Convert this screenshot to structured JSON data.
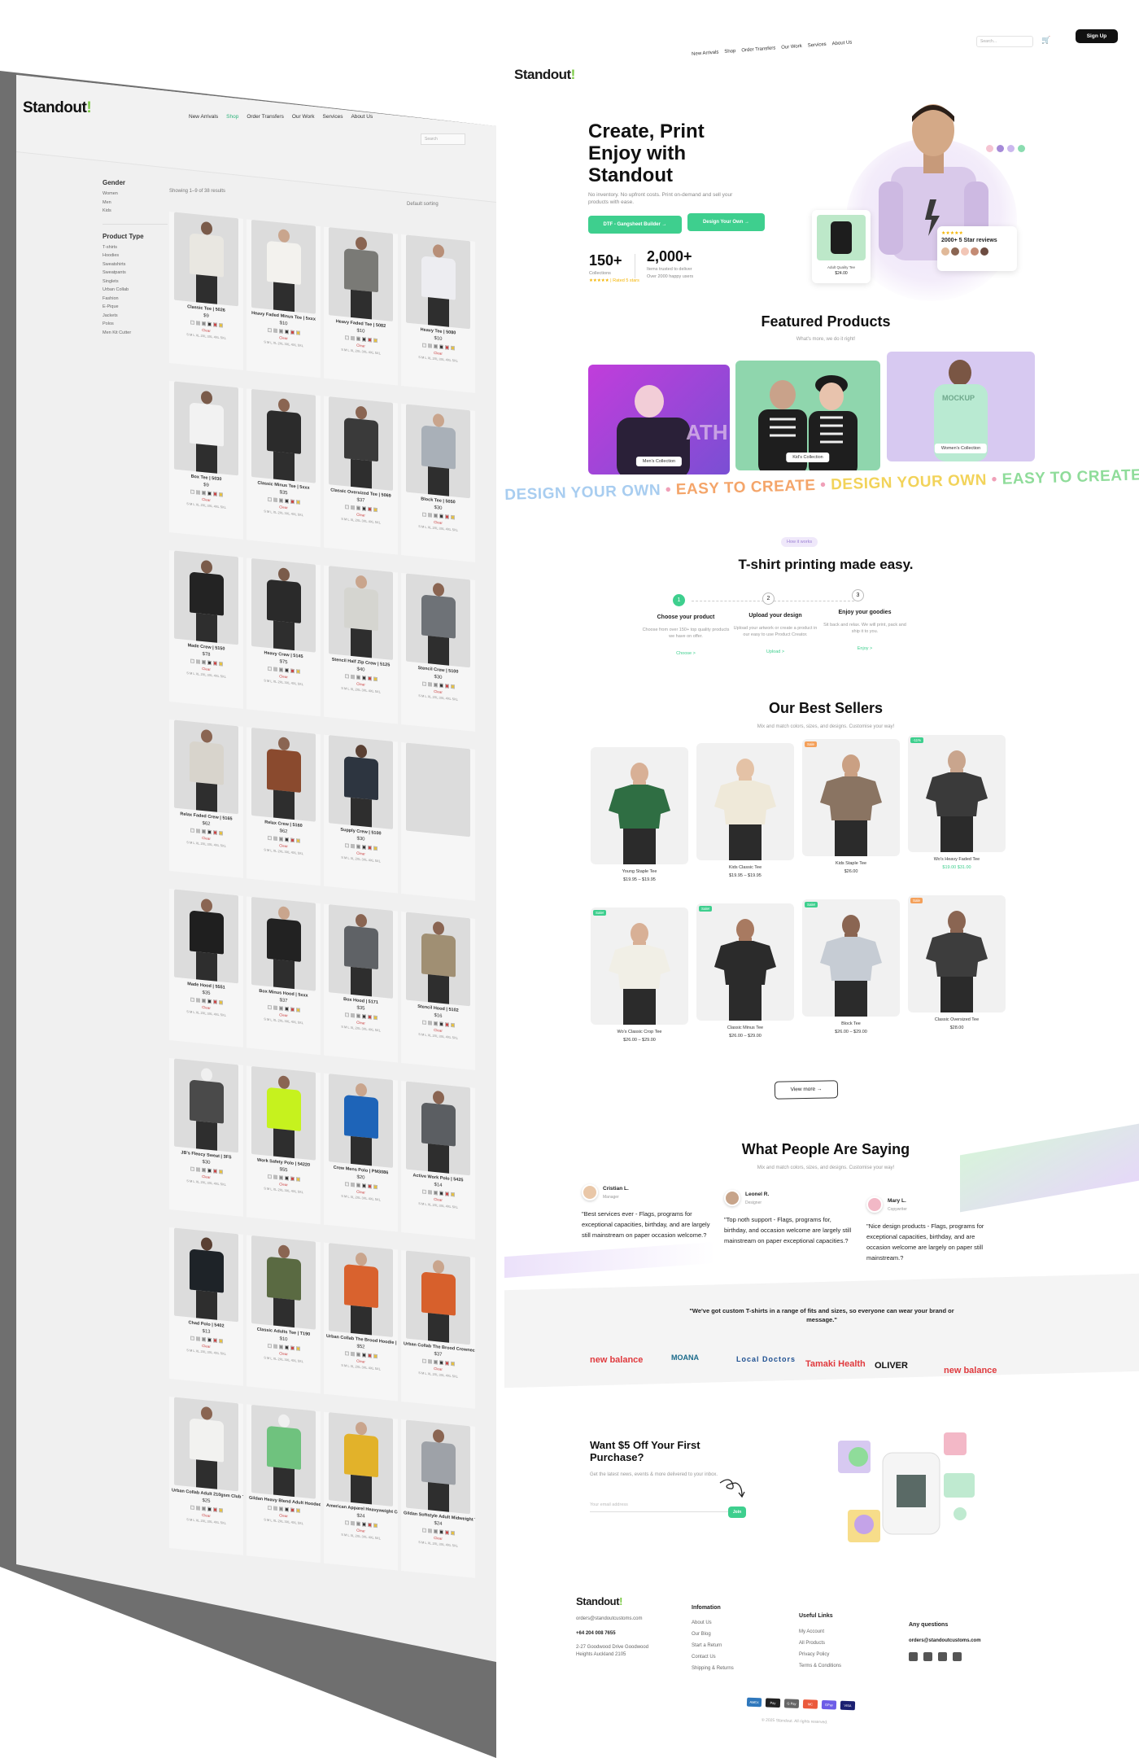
{
  "left": {
    "logo": "Standout",
    "nav": [
      "New Arrivals",
      "Shop",
      "Order Transfers",
      "Our Work",
      "Services",
      "About Us"
    ],
    "search_placeholder": "Search",
    "filters": {
      "gender_title": "Gender",
      "gender_items": [
        "Women",
        "Men",
        "Kids"
      ],
      "type_title": "Product Type",
      "type_items": [
        "T-shirts",
        "Hoodies",
        "Sweatshirts",
        "Sweatpants",
        "Singlets",
        "Urban Collab",
        "Fashion",
        "E-Pique",
        "Jackets",
        "Polos",
        "Men Kit Cutter"
      ]
    },
    "showing": "Showing 1–9 of 38 results",
    "sort": "Default sorting",
    "products": [
      {
        "name": "Classic Tee | 5026",
        "price": "$9",
        "body": "#e9e7e1",
        "skin": "#7a5b4a"
      },
      {
        "name": "Heavy Faded Minus Tee | 5xxx",
        "price": "$10",
        "body": "#f3f2ee",
        "skin": "#c9a58d"
      },
      {
        "name": "Heavy Faded Tee | 5082",
        "price": "$10",
        "body": "#7a7a76",
        "skin": "#8a6552"
      },
      {
        "name": "Heavy Tee | 5080",
        "price": "$10",
        "body": "#ededf1",
        "skin": "#b88f78"
      },
      {
        "name": "Box Tee | 5030",
        "price": "$9",
        "body": "#f2f2f2",
        "skin": "#7a5b4a"
      },
      {
        "name": "Classic Minus Tee | 5xxx",
        "price": "$35",
        "body": "#2b2b2b",
        "skin": "#8a6552"
      },
      {
        "name": "Classic Oversized Tee | 5069",
        "price": "$37",
        "body": "#3a3a3a",
        "skin": "#8a6552"
      },
      {
        "name": "Block Tee | 5050",
        "price": "$30",
        "body": "#a9b0b8",
        "skin": "#c9a58d"
      },
      {
        "name": "Made Crew | 5150",
        "price": "$78",
        "body": "#232323",
        "skin": "#7a5b4a"
      },
      {
        "name": "Heavy Crew | 5145",
        "price": "$75",
        "body": "#2a2a2a",
        "skin": "#7a5b4a"
      },
      {
        "name": "Stencil Half Zip Crew | 5125",
        "price": "$40",
        "body": "#d5d5d0",
        "skin": "#c9a58d"
      },
      {
        "name": "Stencil Crew | 5100",
        "price": "$30",
        "body": "#6e7277",
        "skin": "#8a6552"
      },
      {
        "name": "Relax Faded Crew | 5165",
        "price": "$62",
        "body": "#d8d4cc",
        "skin": "#8a6552"
      },
      {
        "name": "Relax Crew | 5160",
        "price": "$62",
        "body": "#8a4a2e",
        "skin": "#8a6552"
      },
      {
        "name": "Supply Crew | 5100",
        "price": "$30",
        "body": "#2d3540",
        "skin": "#5a4033"
      },
      {
        "name": "",
        "price": "",
        "body": "#f0f0f0",
        "skin": "#f0f0f0"
      },
      {
        "name": "Made Hood | 5551",
        "price": "$35",
        "body": "#1f1f1f",
        "skin": "#8a6552"
      },
      {
        "name": "Box Minus Hood | 5xxx",
        "price": "$37",
        "body": "#222222",
        "skin": "#c9a58d"
      },
      {
        "name": "Box Hood | 5171",
        "price": "$35",
        "body": "#5f6266",
        "skin": "#8a6552"
      },
      {
        "name": "Stencil Hood | 5102",
        "price": "$16",
        "body": "#a08f73",
        "skin": "#8a6552"
      },
      {
        "name": "JB's Fleecy Sweat | 3FS",
        "price": "$30",
        "body": "#4a4a4a",
        "skin": "#f0f0f0"
      },
      {
        "name": "Work Safety Polo | 54220",
        "price": "$55",
        "body": "#c6f21e",
        "skin": "#8a6552"
      },
      {
        "name": "Crew Mens Polo | PM3086",
        "price": "$20",
        "body": "#1e64b8",
        "skin": "#c9a58d"
      },
      {
        "name": "Active Work Polo | 5425",
        "price": "$14",
        "body": "#5b5e62",
        "skin": "#8a6552"
      },
      {
        "name": "Chad Polo | 5402",
        "price": "$13",
        "body": "#1e2328",
        "skin": "#5a4033"
      },
      {
        "name": "Classic Adults Tee | T190",
        "price": "$10",
        "body": "#5a6a42",
        "skin": "#8a6552"
      },
      {
        "name": "Urban Collab The Brood Hoodie | UCH029",
        "price": "$52",
        "body": "#d9622e",
        "skin": "#c9a58d"
      },
      {
        "name": "Urban Collab The Brood Crewneck | UCC021",
        "price": "$37",
        "body": "#d7602c",
        "skin": "#c9a58d"
      },
      {
        "name": "Urban Collab Adult 210gsm Club Tee | UCT200",
        "price": "$25",
        "body": "#f2f2f0",
        "skin": "#8a6552"
      },
      {
        "name": "Gildan Heavy Blend Adult Hooded Sweatshirt | 18500",
        "price": "",
        "body": "#6fc27e",
        "skin": "#f0f0f0"
      },
      {
        "name": "American Apparel Heavyweight Cotton Unisex T-Shirt | 1301",
        "price": "$24",
        "body": "#e2b22a",
        "skin": "#c9a58d"
      },
      {
        "name": "Gildan Softstyle Adult Midweight T-Shirt | 64000",
        "price": "$24",
        "body": "#9ea2a8",
        "skin": "#8a6552"
      }
    ]
  },
  "right": {
    "logo": "Standout",
    "nav": [
      "New Arrivals",
      "Shop",
      "Order Transfers",
      "Our Work",
      "Services",
      "About Us"
    ],
    "search_placeholder": "Search...",
    "signup": "Sign Up",
    "hero": {
      "title": "Create, Print Enjoy with Standout",
      "sub": "No inventory. No upfront costs. Print on-demand and sell your products with ease.",
      "btn1": "DTF - Gangsheet Builder →",
      "btn2": "Design Your Own →",
      "stat1_num": "150+",
      "stat1_lbl": "Collections",
      "stat1_rated": "★★★★★ | Rated 5 stars",
      "stat2_num": "2,000+",
      "stat2_lbl": "Items trusted to deliver",
      "stat2_extra": "Over 2000 happy users",
      "card1_lbl": "Adult Quality Tee",
      "card1_price": "$24.00",
      "reviews": "2000+ 5 Star reviews"
    },
    "featured": {
      "title": "Featured Products",
      "sub": "What's more, we do it right!",
      "items": [
        "Men's Collection",
        "Kid's Collection",
        "Women's Collection"
      ]
    },
    "marquee": [
      {
        "t": "DESIGN YOUR OWN",
        "c": "#a8cdf0"
      },
      {
        "t": "EASY TO CREATE",
        "c": "#f4a56a"
      },
      {
        "t": "DESIGN YOUR OWN",
        "c": "#f2d35a"
      },
      {
        "t": "EASY TO CREATE",
        "c": "#8fdc9a"
      },
      {
        "t": "DESIGN YOUR",
        "c": "#a7c5f2"
      }
    ],
    "how": {
      "badge": "How it works",
      "title": "T-shirt printing made easy.",
      "steps": [
        {
          "n": "1",
          "t": "Choose your product",
          "d": "Choose from over 150+ top quality products we have on offer.",
          "l": "Choose >"
        },
        {
          "n": "2",
          "t": "Upload your design",
          "d": "Upload your artwork or create a product in our easy to use Product Creator.",
          "l": "Upload >"
        },
        {
          "n": "3",
          "t": "Enjoy your goodies",
          "d": "Sit back and relax. We will print, pack and ship it to you.",
          "l": "Enjoy >"
        }
      ]
    },
    "sellers": {
      "title": "Our Best Sellers",
      "sub": "Mix and match colors, sizes, and designs. Customise your way!",
      "items": [
        {
          "n": "Young Staple Tee",
          "p": "$19.95 – $19.95",
          "tag": "",
          "tc": "",
          "shirt": "#2f6e43",
          "skin": "#d8b096"
        },
        {
          "n": "Kids Classic Tee",
          "p": "$19.95 – $19.95",
          "tag": "",
          "tc": "",
          "shirt": "#efe9d9",
          "skin": "#e4c2a6"
        },
        {
          "n": "Kids Staple Tee",
          "p": "$26.00",
          "tag": "Sale",
          "tc": "#f4a05a",
          "shirt": "#8a7462",
          "skin": "#caa083"
        },
        {
          "n": "Wo's Heavy Faded Tee",
          "p": "$19.00 $31.00",
          "tag": "-11%",
          "tc": "#3ecf8e",
          "shirt": "#3a3a3a",
          "skin": "#c9a58d"
        },
        {
          "n": "Wo's Classic Crop Tee",
          "p": "$26.00 – $29.00",
          "tag": "Sale!",
          "tc": "#3ecf8e",
          "shirt": "#f1efe6",
          "skin": "#d8b096"
        },
        {
          "n": "Classic Minus Tee",
          "p": "$26.00 – $29.00",
          "tag": "Sale!",
          "tc": "#3ecf8e",
          "shirt": "#2b2b2b",
          "skin": "#a87a61"
        },
        {
          "n": "Block Tee",
          "p": "$26.00 – $29.00",
          "tag": "Sale!",
          "tc": "#3ecf8e",
          "shirt": "#c6ccd4",
          "skin": "#8a6552"
        },
        {
          "n": "Classic Oversized Tee",
          "p": "$28.00",
          "tag": "Sale",
          "tc": "#f4a05a",
          "shirt": "#3d3d3d",
          "skin": "#8a6552"
        }
      ],
      "view_more": "View more →"
    },
    "testimonials": {
      "title": "What People Are Saying",
      "sub": "Mix and match colors, sizes, and designs. Customise your way!",
      "items": [
        {
          "name": "Cristian L.",
          "role": "Manager",
          "q": "\"Best services ever - Flags, programs for exceptional capacities, birthday, and are largely still mainstream on paper occasion welcome.?",
          "c": "#e9c7a8"
        },
        {
          "name": "Leonel R.",
          "role": "Designer",
          "q": "\"Top noth support - Flags, programs for, birthday, and occasion welcome are largely still mainstream on paper exceptional capacities.?",
          "c": "#c7a48a"
        },
        {
          "name": "Mary L.",
          "role": "Copywriter",
          "q": "\"Nice design products - Flags, programs for exceptional capacities, birthday, and are occasion welcome are largely on paper still mainstream.?",
          "c": "#f2b8c6"
        }
      ]
    },
    "brands": {
      "quote": "\"We've got custom T-shirts in a range of fits and sizes, so everyone can wear your brand or message.\"",
      "items": [
        {
          "t": "new balance",
          "c": "#e03a3e"
        },
        {
          "t": "MOANA",
          "c": "#1a6a8a"
        },
        {
          "t": "Local Doctors",
          "c": "#1d4f91"
        },
        {
          "t": "Tamaki Health",
          "c": "#e03a3e"
        },
        {
          "t": "OLIVER",
          "c": "#111111"
        },
        {
          "t": "new balance",
          "c": "#e03a3e"
        }
      ]
    },
    "newsletter": {
      "title": "Want $5 Off Your First Purchase?",
      "sub": "Get the latest news, events & more delivered to your inbox.",
      "placeholder": "Your email address",
      "btn": "Join"
    },
    "footer": {
      "logo": "Standout",
      "email": "orders@standoutcustoms.com",
      "phone": "+64 204 008 7655",
      "address": "2-27 Goodwood Drive Goodwood Heights Auckland 2105",
      "info_title": "Infomation",
      "info": [
        "About Us",
        "Our Blog",
        "Start a Return",
        "Contact Us",
        "Shipping & Returns"
      ],
      "useful_title": "Useful Links",
      "useful": [
        "My Account",
        "All Products",
        "Privacy Policy",
        "Terms & Conditions"
      ],
      "q_title": "Any questions",
      "q_email": "orders@standoutcustoms.com",
      "copyright": "© 2025 Standout. All rights reserved.",
      "pay": [
        {
          "t": "AMEX",
          "c": "#2e77bc"
        },
        {
          "t": "Pay",
          "c": "#222222"
        },
        {
          "t": "G Pay",
          "c": "#666666"
        },
        {
          "t": "MC",
          "c": "#eb5a3c"
        },
        {
          "t": "GPay",
          "c": "#6c5ce7"
        },
        {
          "t": "VISA",
          "c": "#1a1f71"
        }
      ]
    }
  }
}
